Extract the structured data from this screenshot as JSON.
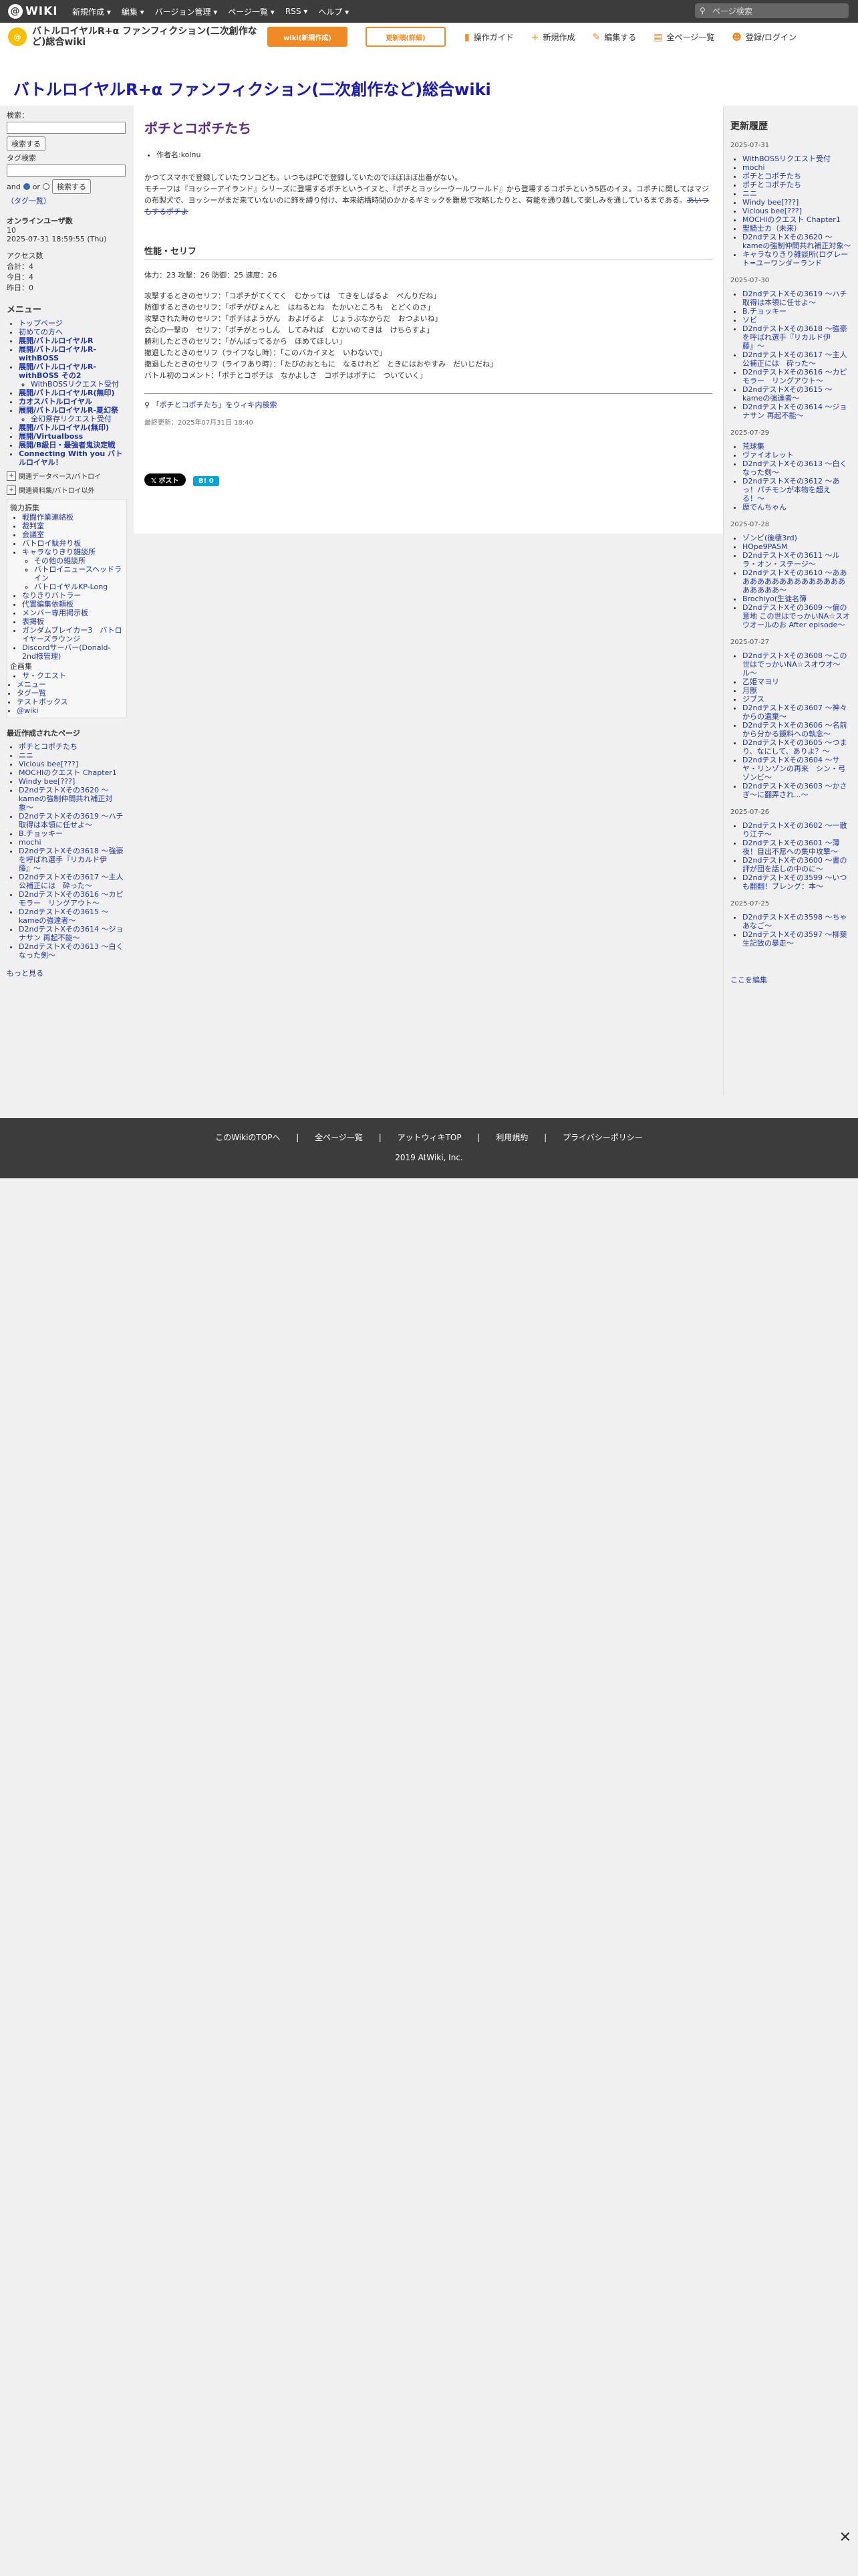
{
  "topbar": {
    "logo": "WIKI",
    "menu": [
      "新規作成 ▾",
      "編集 ▾",
      "バージョン管理 ▾",
      "ページ一覧 ▾",
      "RSS ▾",
      "ヘルプ ▾"
    ],
    "search_placeholder": "ページ検索"
  },
  "subbar": {
    "wiki_name": "バトルロイヤルR+α ファンフィクション(二次創作など)総合wiki",
    "btn_orange": "wiki(新規作成)",
    "btn_white": "更新順(詳細)",
    "actions": [
      "操作ガイド",
      "新規作成",
      "編集する",
      "全ページ一覧",
      "登録/ログイン"
    ]
  },
  "header": {
    "title": "バトルロイヤルR+α ファンフィクション(二次創作など)総合wiki"
  },
  "left": {
    "search_label": "検索：",
    "search_button": "検索する",
    "tag_label": "タグ検索",
    "tag_button": "検索する",
    "and_label": "and",
    "or_label": "or",
    "tag_link": "（タグ一覧）",
    "online_title": "オンラインユーザ数",
    "online_count": "10",
    "datetime": "2025-07-31 18:59:55 (Thu)",
    "access_title": "アクセス数",
    "access_total": "合計：4",
    "access_today": "今日：4",
    "access_yesterday": "昨日：0",
    "menu_title": "メニュー",
    "menu_items": [
      {
        "label": "トップページ",
        "bold": false
      },
      {
        "label": "初めての方へ",
        "bold": false
      },
      {
        "label": "展開/バトルロイヤルR",
        "bold": true
      },
      {
        "label": "展開/バトルロイヤルR-withBOSS",
        "bold": true
      },
      {
        "label": "展開/バトルロイヤルR-withBOSS その2",
        "bold": true
      },
      {
        "label": "WithBOSSリクエスト受付",
        "bold": false,
        "sub": true
      },
      {
        "label": "展開/バトルロイヤルR(無印)",
        "bold": true
      },
      {
        "label": "カオスバトルロイヤル",
        "bold": true
      },
      {
        "label": "展開/バトルロイヤルR-夏幻祭",
        "bold": true
      },
      {
        "label": "全幻祭存リクエスト受付",
        "bold": false,
        "sub": true
      },
      {
        "label": "展開/バトルロイヤル(無印)",
        "bold": true
      },
      {
        "label": "展開/Virtualboss",
        "bold": true
      },
      {
        "label": "展開/B級日・最強者鬼決定戦",
        "bold": true
      },
      {
        "label": "Connecting With you バトルロイヤル！",
        "bold": true
      }
    ],
    "collapse1": "関連データベース/バトロイ",
    "collapse2": "関連資料集/バトロイ以外",
    "tree_root": "微力振集",
    "tree_items": [
      {
        "label": "戦闘作業連絡板",
        "lvl": 2
      },
      {
        "label": "裁判室",
        "lvl": 2
      },
      {
        "label": "会議室",
        "lvl": 2
      },
      {
        "label": "バトロイ駄弁り板",
        "lvl": 2
      },
      {
        "label": "キャラなりきり雑談所",
        "lvl": 2
      },
      {
        "label": "その他の雑談所",
        "lvl": 3
      },
      {
        "label": "バトロイニュースヘッドライン",
        "lvl": 3
      },
      {
        "label": "バトロイヤルKP-Long",
        "lvl": 3
      },
      {
        "label": "なりきりバトラー",
        "lvl": 2
      },
      {
        "label": "代置編集依頼板",
        "lvl": 2
      },
      {
        "label": "メンバー専用掲示板",
        "lvl": 2
      },
      {
        "label": "表掲板",
        "lvl": 2
      },
      {
        "label": "ガンダムブレイカー3　バトロイヤーズラウンジ",
        "lvl": 2
      },
      {
        "label": "Discordサーバー(Donald-2nd様管理)",
        "lvl": 2
      },
      {
        "label": "企画集",
        "lvl": 1
      },
      {
        "label": "サ・クエスト",
        "lvl": 2
      },
      {
        "label": "メニュー",
        "lvl": 1
      },
      {
        "label": "タグ一覧",
        "lvl": 1
      },
      {
        "label": "テストボックス",
        "lvl": 1
      },
      {
        "label": "@wiki",
        "lvl": 1
      }
    ],
    "recent_title": "最近作成されたページ",
    "recent_items": [
      "ポチとコポチたち",
      "ニニ",
      "Vicious bee[???]",
      "MOCHIのクエスト Chapter1",
      "Windy bee[???]",
      "D2ndテストXその3620 〜kameの強制仲間共れ補正対象〜",
      "D2ndテストXその3619 〜ハチ取得は本領に任せよ〜",
      "B.チョッキー",
      "mochi",
      "D2ndテストXその3618 〜強豪を呼ばれ選手『リカルド伊藤』〜",
      "D2ndテストXその3617 〜主人公補正には　砕った〜",
      "D2ndテストXその3616 〜カピモラー　リングアウト〜",
      "D2ndテストXその3615 〜kameの強達者〜",
      "D2ndテストXその3614 〜ジョナサン 再起不能〜",
      "D2ndテストXその3613 〜白くなった剣〜"
    ],
    "more": "もっと見る"
  },
  "main": {
    "title": "ポチとコポチたち",
    "author": "作者名:kolnu",
    "desc1": "かつてスマホで登録していたウンコども。いつもはPCで登録していたのでほぼほぼ出番がない。",
    "desc2": "モチーフは『ヨッシーアイランド』シリーズに登場するポチというイヌと、『ポチとヨッシーウールワールド』から登場するコポチという5匹のイヌ。コポチに関してはマジの布製犬で、ヨッシーがまだ来ていないのに飾を縛り付け、本来結構時間のかかるギミックを難易で攻略したりと、有能を通り越して楽しみを通しているまである。",
    "desc2_strike": "あいつもするポチよ",
    "section": "性能・セリフ",
    "stats": "体力：23 攻撃：26 防御：25 速度：26",
    "lines": [
      "攻撃するときのセリフ：「コポチがてくてく　むかっては　てきをしばるよ　ぺんりだね」",
      "防御するときのセリフ：「ポチがびょんと　はねるとね　たかいところも　とどくのさ」",
      "攻撃された時のセリフ：「ポチはようがん　およげるよ　じょうぶなからだ　おつよいね」",
      "会心の一撃の　セリフ：「ポチがとっしん　してみれば　むかいのてきは　けちらすよ」",
      "勝利したときのセリフ：「がんばってるから　ほめてほしい」",
      "撤退したときのセリフ（ライフなし時）：「このバカイヌと　いわないで」",
      "撤退したときのセリフ（ライフあり時）：「たびのおともに　なるけれど　ときにはおやすみ　だいじだね」",
      "バトル初のコメント：「ポチとコポチは　なかよしさ　コポチはポチに　ついていく」"
    ],
    "search_link": "「ポチとコポチたち」をウィキ内検索",
    "updated": "最終更新：2025年07月31日 18:40",
    "x_button": "𝕏 ポスト",
    "hatena_button": "B! 0"
  },
  "right": {
    "title": "更新履歴",
    "groups": [
      {
        "date": "2025-07-31",
        "items": [
          "WithBOSSリクエスト受付",
          "mochi",
          "ポチとコポチたち",
          "ポチとコポチたち",
          "ニニ",
          "Windy bee[???]",
          "Vicious bee[???]",
          "MOCHIのクエスト Chapter1",
          "聖騎士カ（未来）",
          "D2ndテストXその3620 〜kameの強制仲間共れ補正対象〜",
          "キャラなりきり雑談所(ログレート=ユーワンダーランド"
        ]
      },
      {
        "date": "2025-07-30",
        "items": [
          "D2ndテストXその3619 〜ハチ取得は本領に任せよ〜",
          "B.チョッキー",
          "ソビ",
          "D2ndテストXその3618 〜強豪を呼ばれ選手『リカルド伊藤』〜",
          "D2ndテストXその3617 〜主人公補正には　砕った〜",
          "D2ndテストXその3616 〜カピモラー　リングアウト〜",
          "D2ndテストXその3615 〜kameの強達者〜",
          "D2ndテストXその3614 〜ジョナサン 再起不能〜"
        ]
      },
      {
        "date": "2025-07-29",
        "items": [
          "荒球集",
          "ヴァイオレット",
          "D2ndテストXその3613 〜白くなった剣〜",
          "D2ndテストXその3612 〜あっ！パチモンが本物を超える！〜",
          "歴でんちゃん"
        ]
      },
      {
        "date": "2025-07-28",
        "items": [
          "ゾンビ(後棲3rd)",
          "HOpe9PASM",
          "D2ndテストXその3611 〜ルラ・オン・ステージ〜",
          "D2ndテストXその3610 〜あああああああああああああああああああああ〜",
          "Brochiyo(生徒名簿",
          "D2ndテストXその3609 〜偏の意地 この世はでっかいNA☆スオウオールのお After episode〜"
        ]
      },
      {
        "date": "2025-07-27",
        "items": [
          "D2ndテストXその3608 〜この世はでっかいNA☆スオウオ〜ル〜",
          "乙姫マヨリ",
          "月獣",
          "ジブス",
          "D2ndテストXその3607 〜神々からの遺棄〜",
          "D2ndテストXその3606 〜名前から分かる鏡料への執念〜",
          "D2ndテストXその3605 〜つまり、なにして、ありよ？〜",
          "D2ndテストXその3604 〜サヤ・リンゾンの再来　シン・弓ゾンビ〜",
          "D2ndテストXその3603 〜かさぎ〜に翻弄され...〜"
        ]
      },
      {
        "date": "2025-07-26",
        "items": [
          "D2ndテストXその3602 〜一散り江テ〜",
          "D2ndテストXその3601 〜薄夜！目出不愿への集中攻撃〜",
          "D2ndテストXその3600 〜書の評が団を話しの中のに〜",
          "D2ndテストXその3599 〜いつも翻翻！ブレング：本〜"
        ]
      },
      {
        "date": "2025-07-25",
        "items": [
          "D2ndテストXその3598 〜ちゃあなご〜",
          "D2ndテストXその3597 〜柳葉生記致の暴走〜"
        ]
      }
    ],
    "edit_link": "ここを編集"
  },
  "footer": {
    "links": [
      "このWikiのTOPへ",
      "|",
      "全ページ一覧",
      "|",
      "アットウィキTOP",
      "|",
      "利用規約",
      "|",
      "プライバシーポリシー"
    ],
    "copyright": "2019 AtWiki, Inc."
  },
  "close_symbol": "✕"
}
